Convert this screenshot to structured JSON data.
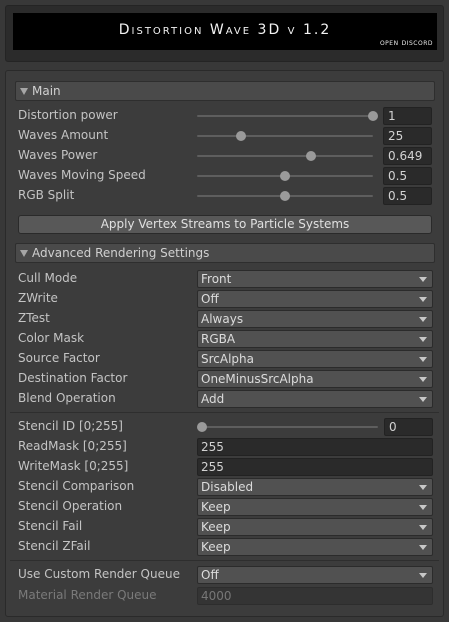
{
  "header": {
    "title": "Distortion Wave 3D v 1.2",
    "link": "Open Discord"
  },
  "main": {
    "label": "Main",
    "sliders": [
      {
        "label": "Distortion power",
        "value": "1",
        "fraction": 1.0
      },
      {
        "label": "Waves Amount",
        "value": "25",
        "fraction": 0.25
      },
      {
        "label": "Waves Power",
        "value": "0.649",
        "fraction": 0.65
      },
      {
        "label": "Waves Moving Speed",
        "value": "0.5",
        "fraction": 0.5
      },
      {
        "label": "RGB Split",
        "value": "0.5",
        "fraction": 0.5
      }
    ],
    "apply_button": "Apply Vertex Streams to Particle Systems"
  },
  "advanced": {
    "label": "Advanced Rendering Settings",
    "cull_mode": {
      "label": "Cull Mode",
      "value": "Front"
    },
    "zwrite": {
      "label": "ZWrite",
      "value": "Off"
    },
    "ztest": {
      "label": "ZTest",
      "value": "Always"
    },
    "color_mask": {
      "label": "Color Mask",
      "value": "RGBA"
    },
    "source_factor": {
      "label": "Source Factor",
      "value": "SrcAlpha"
    },
    "destination_factor": {
      "label": "Destination Factor",
      "value": "OneMinusSrcAlpha"
    },
    "blend_operation": {
      "label": "Blend Operation",
      "value": "Add"
    },
    "stencil_id": {
      "label": "Stencil ID [0;255]",
      "value": "0",
      "fraction": 0.0
    },
    "read_mask": {
      "label": "ReadMask [0;255]",
      "value": "255"
    },
    "write_mask": {
      "label": "WriteMask [0;255]",
      "value": "255"
    },
    "stencil_comparison": {
      "label": "Stencil Comparison",
      "value": "Disabled"
    },
    "stencil_operation": {
      "label": "Stencil Operation",
      "value": "Keep"
    },
    "stencil_fail": {
      "label": "Stencil Fail",
      "value": "Keep"
    },
    "stencil_zfail": {
      "label": "Stencil ZFail",
      "value": "Keep"
    },
    "use_custom_render_queue": {
      "label": "Use Custom Render Queue",
      "value": "Off"
    },
    "material_render_queue": {
      "label": "Material Render Queue",
      "value": "4000"
    }
  },
  "colors": {
    "background": "#383838",
    "field": "#2a2a2a",
    "dropdown": "#515151",
    "text": "#c4c4c4"
  }
}
